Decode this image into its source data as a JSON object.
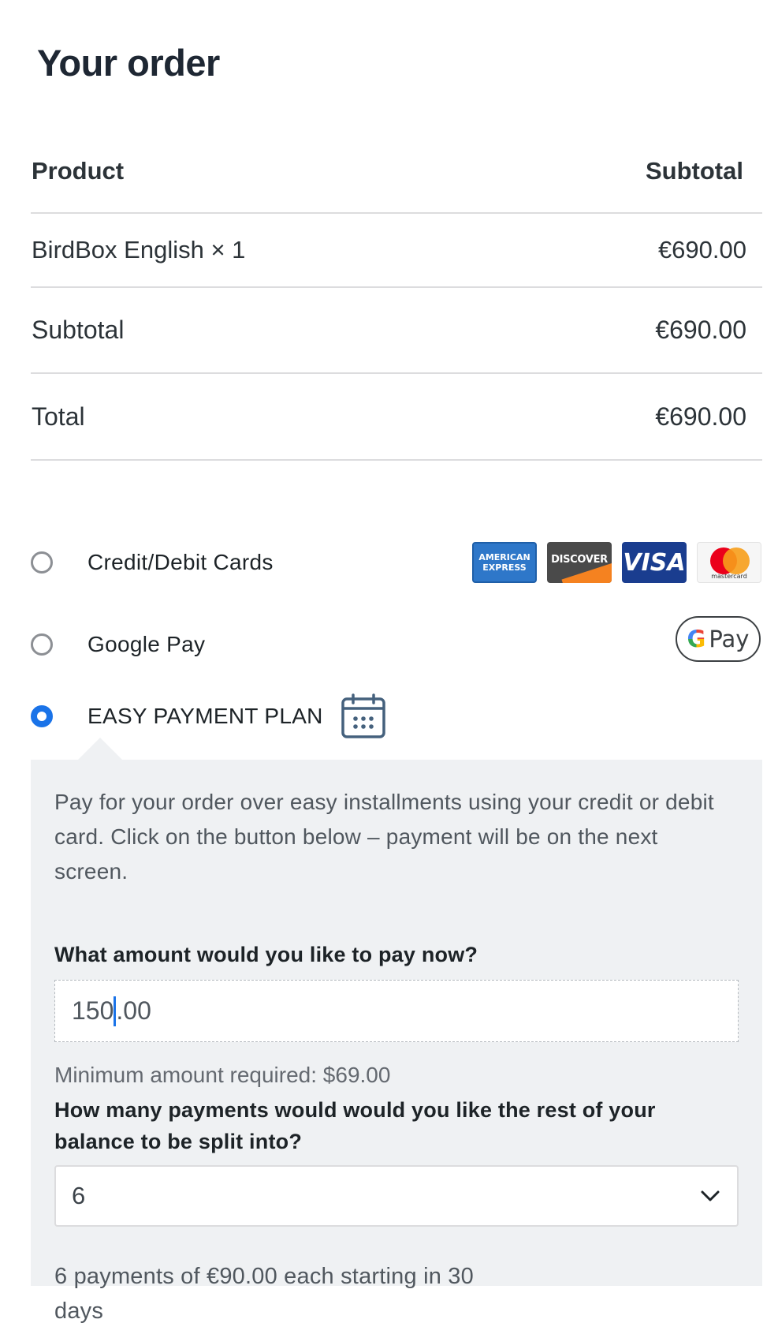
{
  "page": {
    "title": "Your order"
  },
  "order_table": {
    "header": {
      "product": "Product",
      "subtotal": "Subtotal"
    },
    "items": [
      {
        "name": "BirdBox English × 1",
        "price": "€690.00"
      }
    ],
    "subtotal": {
      "label": "Subtotal",
      "value": "€690.00"
    },
    "total": {
      "label": "Total",
      "value": "€690.00"
    }
  },
  "payment_methods": [
    {
      "label": "Credit/Debit Cards",
      "selected": false,
      "icons": [
        "amex-card-icon",
        "discover-card-icon",
        "visa-card-icon",
        "mastercard-icon"
      ]
    },
    {
      "label": "Google Pay",
      "selected": false,
      "icons": [
        "google-pay-icon"
      ]
    },
    {
      "label": "EASY PAYMENT PLAN",
      "selected": true,
      "icons": [
        "calendar-icon"
      ]
    }
  ],
  "card_logos": {
    "amex_line1": "AMERICAN",
    "amex_line2": "EXPRESS",
    "discover": "DISCOVER",
    "visa": "VISA",
    "mastercard": "mastercard",
    "gpay": "Pay",
    "gpay_g": "G"
  },
  "plan": {
    "description": "Pay for your order over easy installments using your credit or debit card. Click on the button below – payment will be on the next screen.",
    "amount_question": "What amount would you like to pay now?",
    "amount_before_caret": "150",
    "amount_after_caret": ".00",
    "min_note": "Minimum amount required: $69.00",
    "split_question": "How many payments would would you like the rest of your balance to be split into?",
    "split_selected": "6",
    "summary": "6 payments of €90.00 each starting in 30 days"
  },
  "colors": {
    "accent": "#1a73e8",
    "title": "#1e2733",
    "box_bg": "#eff1f3",
    "border": "#dcdcde"
  }
}
